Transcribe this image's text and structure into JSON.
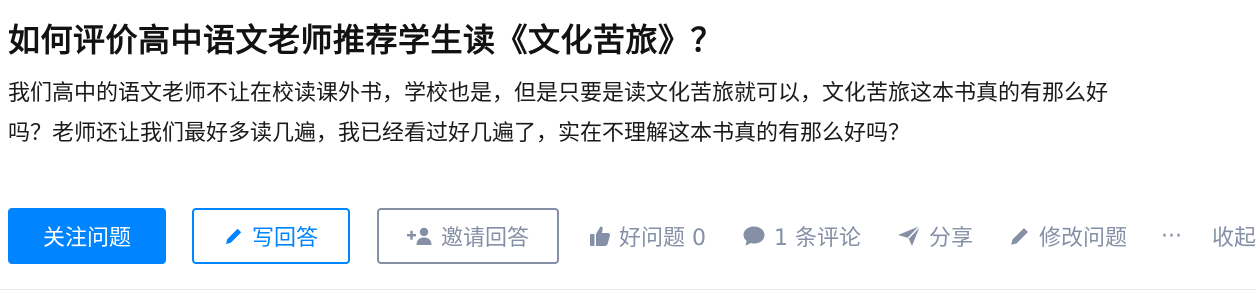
{
  "question": {
    "title": "如何评价高中语文老师推荐学生读《文化苦旅》？",
    "description": "我们高中的语文老师不让在校读课外书，学校也是，但是只要是读文化苦旅就可以，文化苦旅这本书真的有那么好吗？老师还让我们最好多读几遍，我已经看过好几遍了，实在不理解这本书真的有那么好吗？"
  },
  "actions": {
    "follow_label": "关注问题",
    "write_answer_label": "写回答",
    "invite_label": "邀请回答",
    "good_question_label": "好问题 0",
    "comments_label": "1 条评论",
    "share_label": "分享",
    "edit_label": "修改问题",
    "more_label": "···",
    "collapse_label": "收起"
  },
  "icons": {
    "write": "pencil-icon",
    "invite": "add-user-icon",
    "good": "thumbs-up-icon",
    "comment": "comment-bubble-icon",
    "share": "paper-plane-icon",
    "edit": "pencil-icon"
  },
  "colors": {
    "accent": "#0084ff",
    "muted": "#8590a6",
    "text": "#121212"
  }
}
